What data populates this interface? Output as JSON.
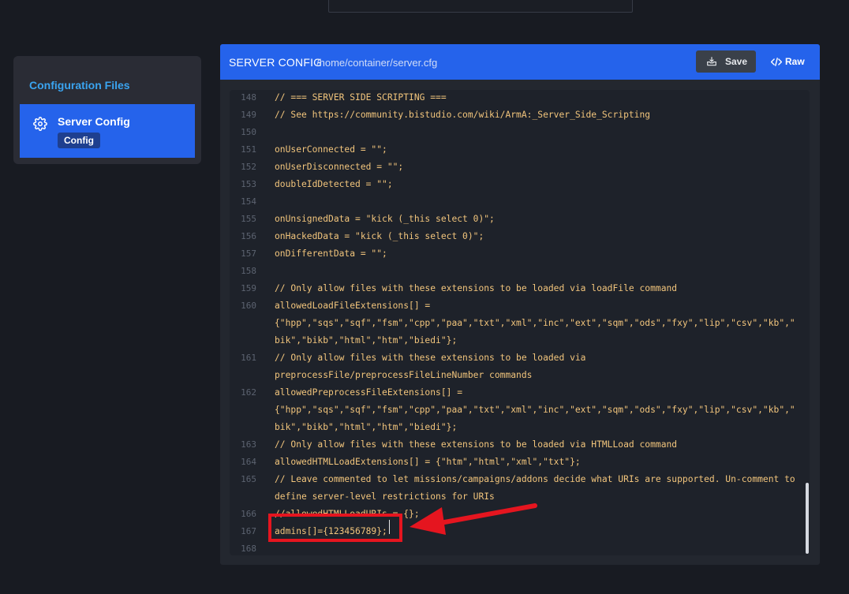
{
  "sidebar": {
    "title": "Configuration Files",
    "items": [
      {
        "label": "Server Config",
        "badge": "Config",
        "icon": "gear-icon"
      }
    ]
  },
  "editor": {
    "title": "SERVER CONFIG",
    "path": "/home/container/server.cfg",
    "save_label": "Save",
    "raw_label": "Raw",
    "lines": [
      {
        "n": "148",
        "t": "// === SERVER SIDE SCRIPTING ==="
      },
      {
        "n": "149",
        "t": "// See https://community.bistudio.com/wiki/ArmA:_Server_Side_Scripting"
      },
      {
        "n": "150",
        "t": ""
      },
      {
        "n": "151",
        "t": "onUserConnected = \"\";"
      },
      {
        "n": "152",
        "t": "onUserDisconnected = \"\";"
      },
      {
        "n": "153",
        "t": "doubleIdDetected = \"\";"
      },
      {
        "n": "154",
        "t": ""
      },
      {
        "n": "155",
        "t": "onUnsignedData = \"kick (_this select 0)\";"
      },
      {
        "n": "156",
        "t": "onHackedData = \"kick (_this select 0)\";"
      },
      {
        "n": "157",
        "t": "onDifferentData = \"\";"
      },
      {
        "n": "158",
        "t": ""
      },
      {
        "n": "159",
        "t": "// Only allow files with these extensions to be loaded via loadFile command"
      },
      {
        "n": "160",
        "t": "allowedLoadFileExtensions[] ="
      },
      {
        "n": "",
        "t": "{\"hpp\",\"sqs\",\"sqf\",\"fsm\",\"cpp\",\"paa\",\"txt\",\"xml\",\"inc\",\"ext\",\"sqm\",\"ods\",\"fxy\",\"lip\",\"csv\",\"kb\",\""
      },
      {
        "n": "",
        "t": "bik\",\"bikb\",\"html\",\"htm\",\"biedi\"};"
      },
      {
        "n": "161",
        "t": "// Only allow files with these extensions to be loaded via"
      },
      {
        "n": "",
        "t": "preprocessFile/preprocessFileLineNumber commands"
      },
      {
        "n": "162",
        "t": "allowedPreprocessFileExtensions[] ="
      },
      {
        "n": "",
        "t": "{\"hpp\",\"sqs\",\"sqf\",\"fsm\",\"cpp\",\"paa\",\"txt\",\"xml\",\"inc\",\"ext\",\"sqm\",\"ods\",\"fxy\",\"lip\",\"csv\",\"kb\",\""
      },
      {
        "n": "",
        "t": "bik\",\"bikb\",\"html\",\"htm\",\"biedi\"};"
      },
      {
        "n": "163",
        "t": "// Only allow files with these extensions to be loaded via HTMLLoad command"
      },
      {
        "n": "164",
        "t": "allowedHTMLLoadExtensions[] = {\"htm\",\"html\",\"xml\",\"txt\"};"
      },
      {
        "n": "165",
        "t": "// Leave commented to let missions/campaigns/addons decide what URIs are supported. Un-comment to"
      },
      {
        "n": "",
        "t": "define server-level restrictions for URIs"
      },
      {
        "n": "166",
        "t": "//allowedHTMLLoadURIs = {};"
      },
      {
        "n": "167",
        "t": "admins[]={123456789};"
      },
      {
        "n": "168",
        "t": ""
      }
    ]
  },
  "colors": {
    "accent": "#2563eb",
    "code_text": "#f2c57c",
    "annotation": "#e5151f"
  }
}
